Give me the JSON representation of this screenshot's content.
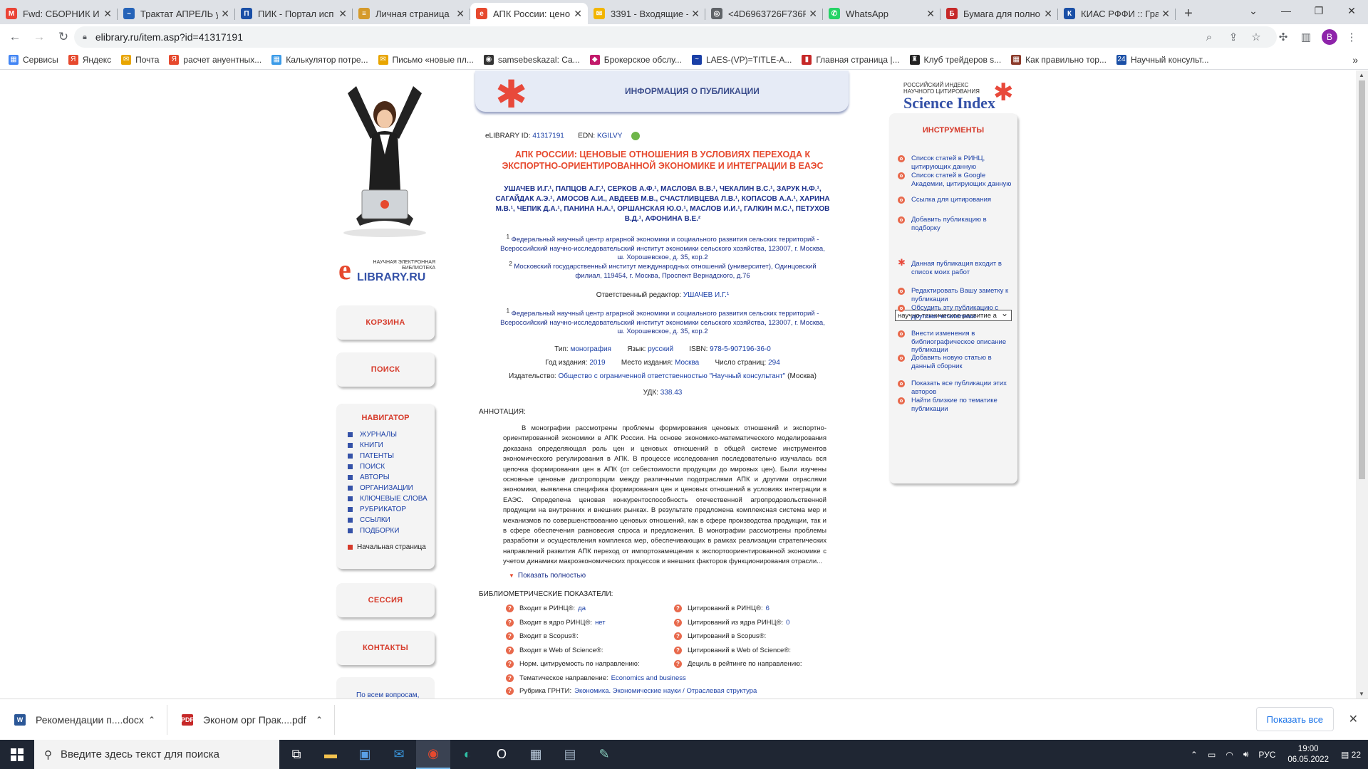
{
  "browser": {
    "tabs": [
      {
        "title": "Fwd: СБОРНИК И",
        "icon": "gmail-icon",
        "color": "#ea4335",
        "glyph": "M"
      },
      {
        "title": "Трактат АПРЕЛЬ у",
        "icon": "edge-swirl-icon",
        "color": "#2563b8",
        "glyph": "~"
      },
      {
        "title": "ПИК - Портал исп",
        "icon": "pik-portal-icon",
        "color": "#1a4fa6",
        "glyph": "П"
      },
      {
        "title": "Личная страница",
        "icon": "book-icon",
        "color": "#d59a2a",
        "glyph": "≡"
      },
      {
        "title": "АПК России: цено",
        "icon": "elibrary-icon",
        "color": "#e6492e",
        "glyph": "e",
        "active": true
      },
      {
        "title": "3391 - Входящие -",
        "icon": "mail-icon",
        "color": "#f2b500",
        "glyph": "✉"
      },
      {
        "title": "<4D6963726F736F",
        "icon": "globe-icon",
        "color": "#5f6368",
        "glyph": "◎"
      },
      {
        "title": "WhatsApp",
        "icon": "whatsapp-icon",
        "color": "#25d366",
        "glyph": "✆"
      },
      {
        "title": "Бумага для полно",
        "icon": "paper-icon",
        "color": "#c62828",
        "glyph": "Б"
      },
      {
        "title": "КИАС РФФИ :: Гра",
        "icon": "kias-icon",
        "color": "#1a4fa6",
        "glyph": "К"
      }
    ],
    "url": "elibrary.ru/item.asp?id=41317191",
    "profile_letter": "В",
    "bookmarks": [
      {
        "label": "Сервисы",
        "color": "#4285f4",
        "glyph": "▦"
      },
      {
        "label": "Яндекс",
        "color": "#e6492e",
        "glyph": "Я"
      },
      {
        "label": "Почта",
        "color": "#e8a500",
        "glyph": "✉"
      },
      {
        "label": "расчет ануентных...",
        "color": "#e6492e",
        "glyph": "Я"
      },
      {
        "label": "Калькулятор потре...",
        "color": "#3b9be8",
        "glyph": "▦"
      },
      {
        "label": "Письмо «новые пл...",
        "color": "#e8a500",
        "glyph": "✉"
      },
      {
        "label": "samsebeskazal: Са...",
        "color": "#333",
        "glyph": "◉"
      },
      {
        "label": "Брокерское обслу...",
        "color": "#c21a6b",
        "glyph": "◆"
      },
      {
        "label": "LAES-(VP)=TITLE-A...",
        "color": "#1a3fa6",
        "glyph": "~"
      },
      {
        "label": "Главная страница |...",
        "color": "#c62828",
        "glyph": "▮"
      },
      {
        "label": "Клуб трейдеров s...",
        "color": "#222",
        "glyph": "♜"
      },
      {
        "label": "Как правильно тор...",
        "color": "#8b3a2a",
        "glyph": "▦"
      },
      {
        "label": "Научный консульт...",
        "color": "#1a4fa6",
        "glyph": "24"
      }
    ]
  },
  "left": {
    "buttons": {
      "cart": "КОРЗИНА",
      "search": "ПОИСК",
      "session": "СЕССИЯ",
      "contacts": "КОНТАКТЫ"
    },
    "navigator_title": "НАВИГАТОР",
    "nav_items": [
      "ЖУРНАЛЫ",
      "КНИГИ",
      "ПАТЕНТЫ",
      "ПОИСК",
      "АВТОРЫ",
      "ОРГАНИЗАЦИИ",
      "КЛЮЧЕВЫЕ СЛОВА",
      "РУБРИКАТОР",
      "ССЫЛКИ",
      "ПОДБОРКИ"
    ],
    "home": "Начальная страница",
    "logo_small": "НАУЧНАЯ ЭЛЕКТРОННАЯ БИБЛИОТЕКА",
    "logo_big": "LIBRARY.RU",
    "bottom_note": "По всем вопросам,"
  },
  "pub": {
    "header": "ИНФОРМАЦИЯ О ПУБЛИКАЦИИ",
    "elib_id_label": "eLIBRARY ID:",
    "elib_id": "41317191",
    "edn_label": "EDN:",
    "edn": "KGILVY",
    "title": "АПК РОССИИ: ЦЕНОВЫЕ ОТНОШЕНИЯ В УСЛОВИЯХ ПЕРЕХОДА К ЭКСПОРТНО-ОРИЕНТИРОВАННОЙ ЭКОНОМИКЕ И ИНТЕГРАЦИИ В ЕАЭС",
    "authors": "УШАЧЕВ И.Г.¹, ПАПЦОВ А.Г.¹, СЕРКОВ А.Ф.¹, МАСЛОВА В.В.¹, ЧЕКАЛИН В.С.¹, ЗАРУК Н.Ф.¹, САГАЙДАК А.Э.¹, АМОСОВ А.И., АВДЕЕВ М.В., СЧАСТЛИВЦЕВА Л.В.¹, КОПАСОВ А.А.¹, ХАРИНА М.В.¹, ЧЕПИК Д.А.¹, ПАНИНА Н.А.¹, ОРШАНСКАЯ Ю.О.¹, МАСЛОВ И.И.¹, ГАЛКИН М.С.¹, ПЕТУХОВ В.Д.¹, АФОНИНА В.Е.²",
    "aff1": "Федеральный научный центр аграрной экономики и социального развития сельских территорий - Всероссийский научно-исследовательский институт экономики сельского хозяйства, 123007, г. Москва, ш. Хорошевское, д. 35, кор.2",
    "aff2": "Московский государственный институт международных отношений (университет), Одинцовский филиал, 119454, г. Москва, Проспект Вернадского, д.76",
    "editor_label": "Ответственный редактор:",
    "editor": "УШАЧЕВ И.Г.¹",
    "aff3": "Федеральный научный центр аграрной экономики и социального развития сельских территорий - Всероссийский научно-исследовательский институт экономики сельского хозяйства, 123007, г. Москва, ш. Хорошевское, д. 35, кор.2",
    "type_label": "Тип:",
    "type": "монография",
    "lang_label": "Язык:",
    "lang": "русский",
    "isbn_label": "ISBN:",
    "isbn": "978-5-907196-36-0",
    "year_label": "Год издания:",
    "year": "2019",
    "place_label": "Место издания:",
    "place": "Москва",
    "pages_label": "Число страниц:",
    "pages": "294",
    "publisher_label": "Издательство:",
    "publisher": "Общество с ограниченной ответственностью \"Научный консультант\"",
    "publisher_city": "(Москва)",
    "udk_label": "УДК:",
    "udk": "338.43",
    "annotation_label": "АННОТАЦИЯ:",
    "annotation": "В монографии рассмотрены проблемы формирования ценовых отношений и экспортно-ориентированной экономики в АПК России. На основе экономико-математического моделирования доказана определяющая роль цен и ценовых отношений в общей системе инструментов экономического регулирования в АПК. В процессе исследования последовательно изучалась вся цепочка формирования цен в АПК (от себестоимости продукции до мировых цен). Были изучены основные ценовые диспропорции между различными подотраслями АПК и другими отраслями экономики, выявлена специфика формирования цен и ценовых отношений в условиях интеграции в ЕАЭС. Определена ценовая конкурентоспособность отечественной агропродовольственной продукции на внутренних и внешних рынках. В результате предложена комплексная система мер и механизмов по совершенствованию ценовых отношений, как в сфере производства продукции, так и в сфере обеспечения равновесия спроса и предложения. В монографии рассмотрены проблемы разработки и осуществления комплекса мер, обеспечивающих в рамках реализации стратегических направлений развития АПК переход от импортозамещения к экспортоориентированной экономике с учетом динамики макроэкономических процессов и внешних факторов функционирования отрасли...",
    "show_full": "Показать полностью",
    "biblio_label": "БИБЛИОМЕТРИЧЕСКИЕ ПОКАЗАТЕЛИ:",
    "metrics_left": [
      {
        "label": "Входит в РИНЦ®:",
        "value": "да"
      },
      {
        "label": "Входит в ядро РИНЦ®:",
        "value": "нет"
      },
      {
        "label": "Входит в Scopus®:",
        "value": ""
      },
      {
        "label": "Входит в Web of Science®:",
        "value": ""
      },
      {
        "label": "Норм. цитируемость по направлению:",
        "value": ""
      },
      {
        "label": "Тематическое направление:",
        "value": "Economics and business"
      },
      {
        "label": "Рубрика ГРНТИ:",
        "value": "Экономика. Экономические науки / Отраслевая структура"
      }
    ],
    "metrics_right": [
      {
        "label": "Цитирований в РИНЦ®:",
        "value": "6"
      },
      {
        "label": "Цитирований из ядра РИНЦ®:",
        "value": "0"
      },
      {
        "label": "Цитирований в Scopus®:",
        "value": ""
      },
      {
        "label": "Цитирований в Web of Science®:",
        "value": ""
      },
      {
        "label": "Дециль в рейтинге по направлению:",
        "value": ""
      }
    ]
  },
  "right": {
    "sci_small": "РОССИЙСКИЙ ИНДЕКС НАУЧНОГО ЦИТИРОВАНИЯ",
    "sci_big": "Science Index",
    "tools_title": "ИНСТРУМЕНТЫ",
    "tools": [
      "Список статей в РИНЦ, цитирующих данную",
      "Список статей в Google Академии, цитирующих данную",
      "Ссылка для цитирования",
      "Добавить публикацию в подборку",
      "Данная публикация входит в список моих работ",
      "Редактировать Вашу заметку к публикации",
      "Обсудить эту публикацию с другими читателями",
      "Внести изменения в библиографическое описание публикации",
      "Добавить новую статью в данный сборник",
      "Показать все публикации этих авторов",
      "Найти близкие по тематике публикации"
    ],
    "select_value": "научно-техническое развитие а"
  },
  "downloads": [
    {
      "name": "Рекомендации п....docx",
      "icon": "word-doc-icon",
      "color": "#2b5797",
      "glyph": "W"
    },
    {
      "name": "Эконом орг Прак....pdf",
      "icon": "pdf-icon",
      "color": "#c62828",
      "glyph": "PDF"
    }
  ],
  "downloads_show_all": "Показать все",
  "taskbar": {
    "search_placeholder": "Введите здесь текст для поиска",
    "lang": "РУС",
    "time": "19:00",
    "date": "06.05.2022",
    "notif": "22"
  }
}
